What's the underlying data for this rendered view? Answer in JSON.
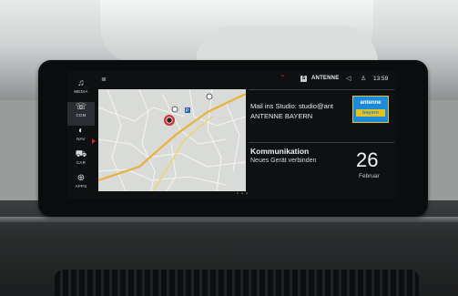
{
  "sidebar": {
    "items": [
      {
        "label": "MEDIA",
        "icon": "music-note-icon",
        "glyph": "♫",
        "active": false
      },
      {
        "label": "COM",
        "icon": "phone-screen-icon",
        "glyph": "☏",
        "active": true
      },
      {
        "label": "NAV",
        "icon": "navigation-icon",
        "glyph": "◐",
        "active": false
      },
      {
        "label": "CAR",
        "icon": "car-icon",
        "glyph": "⛟",
        "active": false
      },
      {
        "label": "APPS",
        "icon": "apps-icon",
        "glyph": "⊕",
        "active": false
      }
    ]
  },
  "status": {
    "menu_glyph": "≣",
    "alert_glyph": "⌃",
    "source_badge": "S",
    "station": "ANTENNE",
    "volume_glyph": "◁",
    "user_glyph": "♙",
    "time": "13:59"
  },
  "radio_widget": {
    "line1": "Mail ins Studio: studio@ant",
    "line2": "ANTENNE BAYERN",
    "logo_top": "antenne",
    "logo_bottom": "bayern"
  },
  "comm_widget": {
    "title": "Kommunikation",
    "subtitle": "Neues Gerät verbinden",
    "day": "26",
    "month": "Februar"
  },
  "map": {
    "poi_label": "P"
  },
  "pager": "• • •",
  "colors": {
    "accent_red": "#c8262a",
    "logo_blue": "#1d8ad8",
    "logo_yellow": "#e6c21f"
  }
}
